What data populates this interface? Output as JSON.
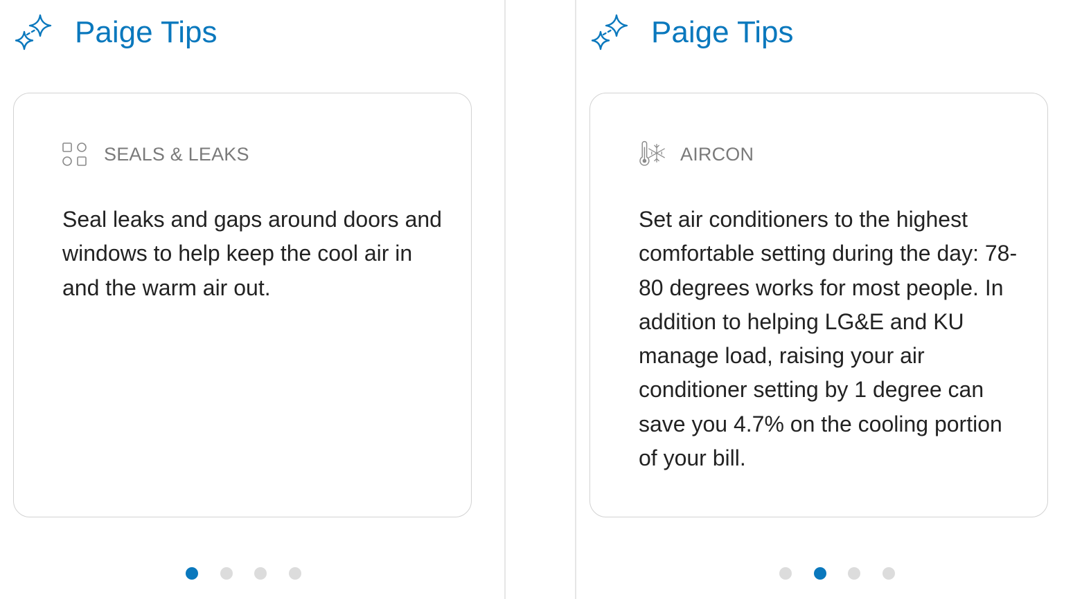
{
  "colors": {
    "accent": "#0a78bd",
    "card_border": "#d2d2d2",
    "dot_inactive": "#dcdcdc",
    "category_text": "#7a7a7a",
    "body_text": "#222222"
  },
  "panels": [
    {
      "header": {
        "icon": "sparkle-icon",
        "title": "Paige Tips"
      },
      "card": {
        "category_icon": "shapes-grid-icon",
        "category": "SEALS & LEAKS",
        "tip": "Seal leaks and gaps around doors and windows to help keep the cool air in and the warm air out."
      },
      "pagination": {
        "total": 4,
        "active": 1
      }
    },
    {
      "header": {
        "icon": "sparkle-icon",
        "title": "Paige Tips"
      },
      "card": {
        "category_icon": "thermometer-snowflake-icon",
        "category": "AIRCON",
        "tip": "Set air conditioners to the highest comfortable setting during the day: 78-80 degrees works for most people. In addition to helping LG&E and KU manage load, raising your air conditioner setting by 1 degree can save you 4.7% on the cooling portion of your bill."
      },
      "pagination": {
        "total": 4,
        "active": 2
      }
    }
  ]
}
